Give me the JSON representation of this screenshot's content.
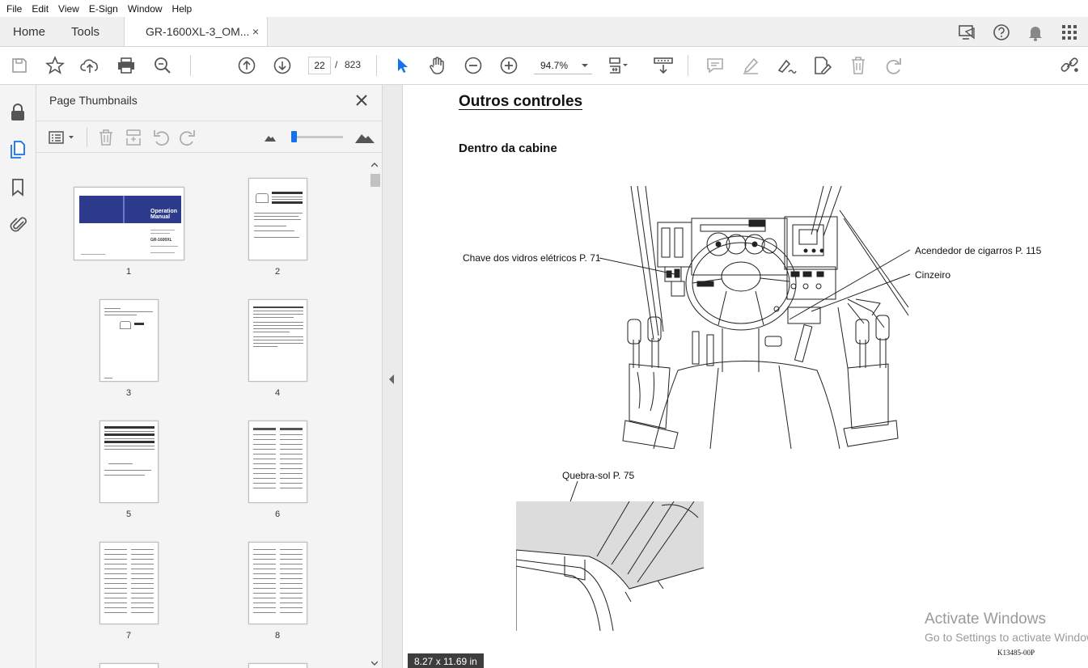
{
  "menubar": {
    "items": [
      "File",
      "Edit",
      "View",
      "E-Sign",
      "Window",
      "Help"
    ]
  },
  "tabs": {
    "home": "Home",
    "tools": "Tools",
    "document": "GR-1600XL-3_OM...",
    "close": "×"
  },
  "toolbar": {
    "current_page": "22",
    "separator": "/",
    "total_pages": "823",
    "zoom": "94.7%"
  },
  "thumbnails_panel": {
    "title": "Page Thumbnails",
    "close": "×",
    "pages": [
      "1",
      "2",
      "3",
      "4",
      "5",
      "6",
      "7",
      "8"
    ],
    "cover": {
      "title_line1": "Operation",
      "title_line2": "Manual",
      "model": "GR-1600XL"
    }
  },
  "document": {
    "heading": "Outros controles",
    "subheading": "Dentro da cabine",
    "callouts": {
      "window_switch": "Chave dos vidros elétricos P. 71",
      "cigar_lighter": "Acendedor de cigarros P. 115",
      "ashtray": "Cinzeiro",
      "sun_visor": "Quebra-sol P. 75"
    },
    "figure_code": "K13485-00P",
    "page_size": "8.27 x 11.69 in"
  },
  "os_overlay": {
    "watermark_title": "Activate Windows",
    "watermark_sub": "Go to Settings to activate Windows."
  },
  "colors": {
    "accent": "#1473e6",
    "cover_blue": "#2e3a8c"
  }
}
